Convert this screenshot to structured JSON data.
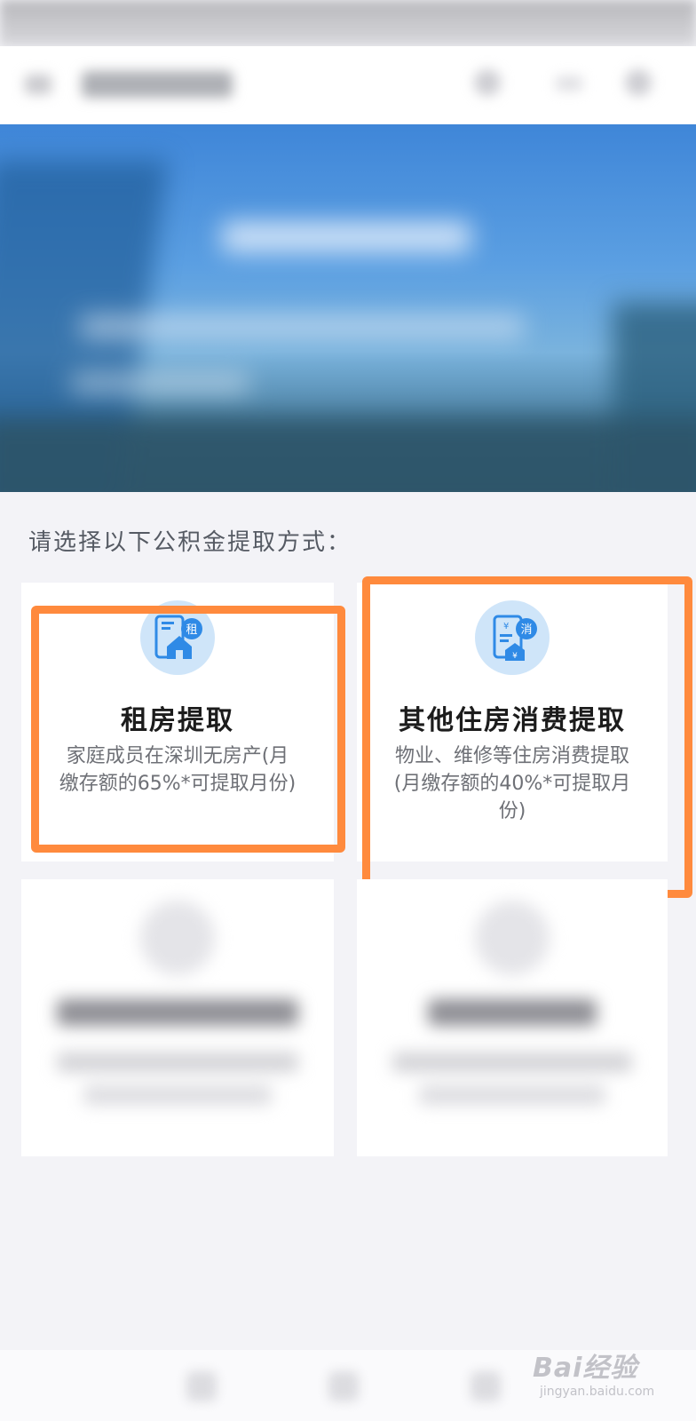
{
  "section": {
    "title": "请选择以下公积金提取方式："
  },
  "cards": [
    {
      "title": "租房提取",
      "badge": "租",
      "description": "家庭成员在深圳无房产(月缴存额的65%*可提取月份)",
      "highlighted": true,
      "icon": "rent-house-icon"
    },
    {
      "title": "其他住房消费提取",
      "badge": "消",
      "description": "物业、维修等住房消费提取(月缴存额的40%*可提取月份)",
      "highlighted": true,
      "icon": "housing-consumption-icon"
    }
  ],
  "highlight_color": "#ff8a3d",
  "watermark": {
    "main": "Bai经验",
    "sub": "jingyan.baidu.com"
  }
}
